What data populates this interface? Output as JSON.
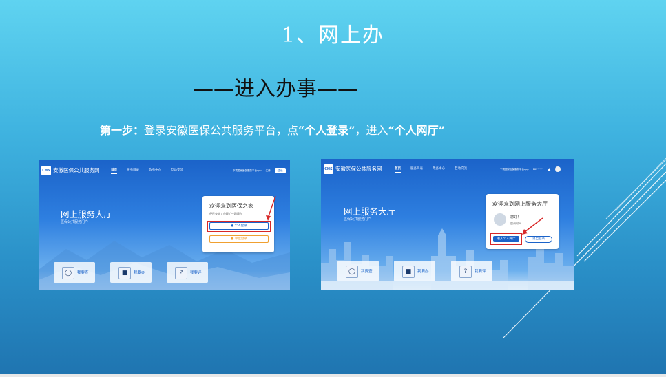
{
  "slide": {
    "title": "1、网上办",
    "subtitle": "——进入办事——",
    "step_label": "第一步：",
    "step_text_1": "登录安徽医保公共服务平台，点",
    "step_highlight_1": "“个人登录”",
    "step_text_2": "，进入",
    "step_highlight_2": "“个人网厅”"
  },
  "shot1": {
    "logo": "CHS",
    "site_name": "安徽医保公共服务网",
    "nav": [
      "首页",
      "服务目录",
      "政务中心",
      "互动交流"
    ],
    "nav_right": "下载国家医保服务平台app",
    "register": "注册",
    "login": "登录",
    "hall_title": "网上服务大厅",
    "hall_sub": "医保公共服务门户",
    "card_title": "欢迎来到医保之家",
    "card_sub": "便民查询 / 办理 / 一网通办",
    "personal_login": "个人登录",
    "unit_login": "单位登录",
    "services": [
      "我要查",
      "我要办",
      "我要评"
    ]
  },
  "shot2": {
    "logo": "CHS",
    "site_name": "安徽医保公共服务网",
    "nav": [
      "首页",
      "服务目录",
      "政务中心",
      "互动交流"
    ],
    "nav_right": "下载国家医保服务平台app",
    "user": "189*****",
    "hall_title": "网上服务大厅",
    "hall_sub": "医保公共服务门户",
    "card_title": "欢迎来到网上服务大厅",
    "greeting": "您好！",
    "greeting_sub": "登录时间",
    "enter_hall": "进入个人网厅",
    "logout": "退出登录",
    "services": [
      "我要查",
      "我要办",
      "我要评"
    ]
  },
  "colors": {
    "accent": "#1b63c9",
    "highlight_red": "#d82828",
    "unit_orange": "#f0a030"
  }
}
